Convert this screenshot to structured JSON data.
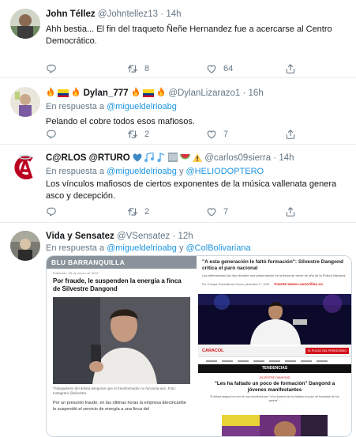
{
  "tweets": [
    {
      "name": "John Téllez",
      "handle": "@Johntellez13",
      "dot": "·",
      "time": "14h",
      "text": "Ahh bestia... El fin del traqueto Ñeñe Hernandez fue a acercarse al Centro Democrático.",
      "retweets": "8",
      "likes": "64"
    },
    {
      "name": "Dylan_777",
      "handle": "@DylanLizarazo1",
      "dot": "·",
      "time": "16h",
      "reply_prefix": "En respuesta a",
      "reply_to": "@migueldelrioabg",
      "text": "Pelando el cobre todos esos mafiosos.",
      "retweets": "2",
      "likes": "7"
    },
    {
      "name": "C@RLOS @RTURO",
      "handle": "@carlos09sierra",
      "dot": "·",
      "time": "14h",
      "reply_prefix": "En respuesta a",
      "reply_to": "@migueldelrioabg",
      "reply_and": "y",
      "reply_to2": "@HELIODOPTERO",
      "text": "Los vínculos mafiosos de ciertos exponentes de la música vallenata genera asco y decepción.",
      "retweets": "2",
      "likes": "7"
    },
    {
      "name": "Vida y Sensatez",
      "handle": "@VSensatez",
      "dot": "·",
      "time": "12h",
      "reply_prefix": "En respuesta a",
      "reply_to": "@migueldelrioabg",
      "reply_and": "y",
      "reply_to2": "@ColBolivariana"
    }
  ],
  "media_left": {
    "brand": "BLU BARRANQUILLA",
    "date": "Publicado: 05 de marzo de 2019",
    "headline": "Por fraude, le suspenden la energía a finca de Silvestre Dangond",
    "caption": "Trabajadores del artista aseguran que el transformador no funciona aún. Foto: Instagram @silvestre",
    "body": "Por un presunto fraude, en las últimas horas la empresa Electricaribe le suspendió el servicio de energía a una finca del"
  },
  "media_right": {
    "headline": "\"A esta generación le faltó formación\": Silvestre Dangond critica el paro nacional",
    "sub": "Las afirmaciones las hizo durante una presentación en la fiesta de cierre de año de la Policía Nacional",
    "byline": "Por: Enrique Tchuentlicozh Olmos | diciembre 17, 2019",
    "source": "Fuente:www.Las2orillas.co",
    "channel": "CARACOL",
    "channel_right": "EL PULSO DEL PERIODISMO",
    "section": "TENDENCIAS",
    "kicker": "SILVESTRE DANGOND",
    "headline2": "\"Les ha faltado un poco de formación\" Dangond a jóvenes manifestantes",
    "body2": "El artista aseguró en uno de sus conciertos que \"a los jóvenes les ha faltado un poco de formación de los padres\"..."
  },
  "colors": {
    "accent": "#1b95e0",
    "muted": "#657786",
    "border": "#e6ecf0",
    "fire": "#ff7a00",
    "caracol_red": "#d1121b",
    "blu_header": "#8a939b"
  },
  "icons": [
    "reply-icon",
    "retweet-icon",
    "like-icon",
    "share-icon"
  ]
}
